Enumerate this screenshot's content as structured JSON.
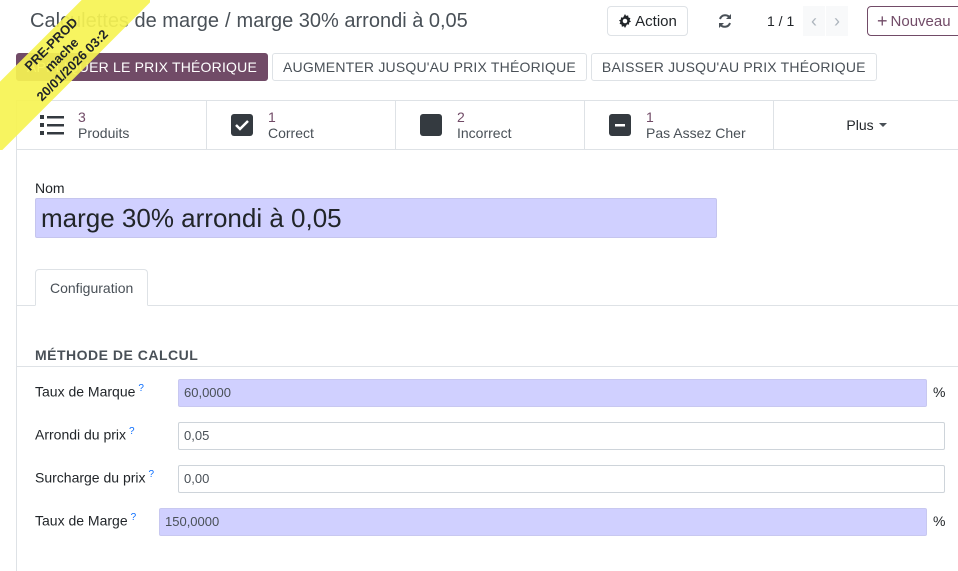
{
  "breadcrumb": {
    "parent": "Calculettes de marge",
    "separator": "/",
    "current": "marge 30% arrondi à 0,05"
  },
  "toolbar": {
    "action_label": "Action",
    "pager": "1 / 1",
    "new_label": "Nouveau"
  },
  "header_buttons": [
    "APPLIQUER LE PRIX THÉORIQUE",
    "AUGMENTER JUSQU'AU PRIX THÉORIQUE",
    "BAISSER JUSQU'AU PRIX THÉORIQUE"
  ],
  "smart_buttons": [
    {
      "value": "3",
      "label": "Produits",
      "icon": "list-icon"
    },
    {
      "value": "1",
      "label": "Correct",
      "icon": "check-square-icon"
    },
    {
      "value": "2",
      "label": "Incorrect",
      "icon": "square-icon"
    },
    {
      "value": "1",
      "label": "Pas Assez Cher",
      "icon": "minus-square-icon"
    },
    {
      "label": "Plus"
    }
  ],
  "form": {
    "name_label": "Nom",
    "name_value": "marge 30% arrondi à 0,05",
    "tab": "Configuration",
    "section_title": "MÉTHODE DE CALCUL",
    "fields": [
      {
        "label": "Taux de Marque",
        "help": "?",
        "value": "60,0000",
        "suffix": "%"
      },
      {
        "label": "Arrondi du prix",
        "help": "?",
        "value": "0,05"
      },
      {
        "label": "Surcharge du prix",
        "help": "?",
        "value": "0,00"
      },
      {
        "label": "Taux de Marge",
        "help": "?",
        "value": "150,0000",
        "suffix": "%"
      }
    ]
  },
  "ribbon": {
    "line1": "PRE-PROD",
    "line2": "mache",
    "line3": "20/01/2026 03:2"
  },
  "colors": {
    "primary": "#714b67",
    "readonly_bg": "#d0d0ff",
    "ribbon": "#f6f353"
  }
}
